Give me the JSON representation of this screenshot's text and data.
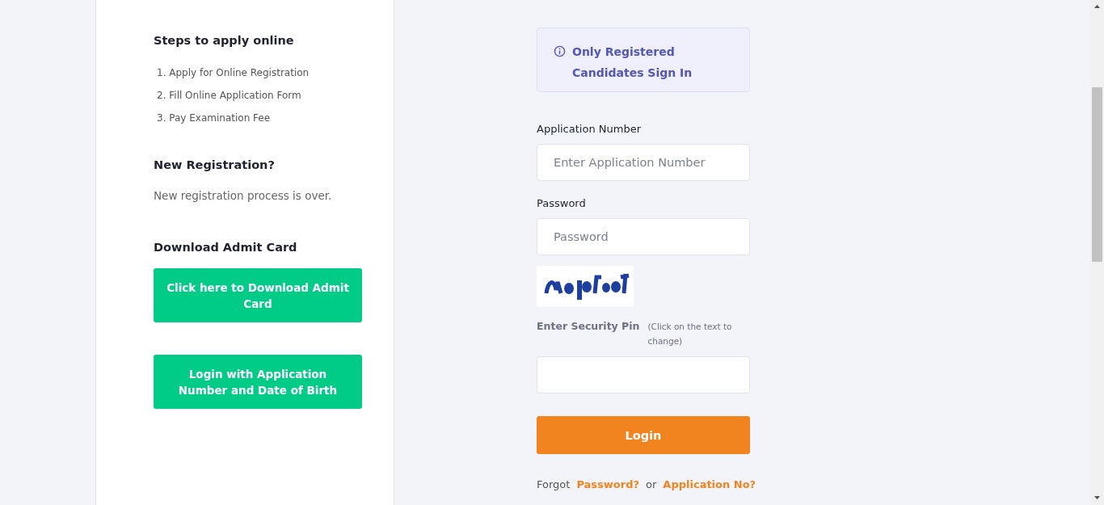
{
  "steps": {
    "title": "Steps to apply online",
    "items": [
      "1. Apply for Online Registration",
      "2. Fill Online Application Form",
      "3. Pay Examination Fee"
    ]
  },
  "registration": {
    "title": "New Registration?",
    "message": "New registration process is over."
  },
  "admit_card": {
    "title": "Download Admit Card",
    "buttons": [
      "Click here to Download Admit Card",
      "Login with Application Number and Date of Birth"
    ]
  },
  "notice": {
    "text": "Only Registered Candidates Sign In"
  },
  "form": {
    "fields": [
      {
        "label": "Application Number",
        "placeholder": "Enter Application Number"
      },
      {
        "label": "Password",
        "placeholder": "Password"
      }
    ],
    "security_pin": {
      "label": "Enter Security Pin",
      "hint": "(Click on the text to change)"
    },
    "login_button": "Login",
    "forgot": {
      "text": "Forgot",
      "links": [
        "Password?",
        "Application No?"
      ],
      "separator": "or"
    }
  }
}
